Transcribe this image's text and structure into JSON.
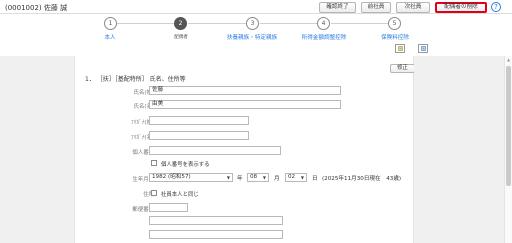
{
  "header": {
    "employee": "(0001002) 佐藤 誠",
    "buttons": {
      "confirm": "確認終了",
      "prev": "前社員",
      "next": "次社員",
      "delete_spouse": "配偶者の削除"
    },
    "help": "?"
  },
  "steps": [
    {
      "num": "1",
      "label": "本人"
    },
    {
      "num": "2",
      "label": "配偶者"
    },
    {
      "num": "3",
      "label": "扶養親族・特定親族"
    },
    {
      "num": "4",
      "label": "所得金額調整控除"
    },
    {
      "num": "5",
      "label": "保険料控除"
    }
  ],
  "current_step": 2,
  "form": {
    "fix_button": "修正",
    "section_title": "1． ［扶］［基配特所］ 氏名、住所等",
    "labels": {
      "last_name": "氏名(姓)",
      "first_name": "氏名(名)",
      "kana_last": "ﾌﾘｶﾞﾅ(姓)",
      "kana_first": "ﾌﾘｶﾞﾅ(名)",
      "my_number": "個人番号",
      "birth": "生年月日",
      "address": "住所",
      "postal": "郵便番号"
    },
    "values": {
      "last_name": "佐藤",
      "first_name": "由美",
      "kana_last": "",
      "kana_first": "",
      "my_number": "",
      "postal": ""
    },
    "show_my_number": "個人番号を表示する",
    "birth": {
      "year": "1982 (昭和57)",
      "year_unit": "年",
      "month": "08",
      "month_unit": "月",
      "day": "02",
      "day_unit": "日",
      "age_note": "(2025年11月30日現在　43歳)"
    },
    "same_as_self": "社員本人と同じ"
  }
}
